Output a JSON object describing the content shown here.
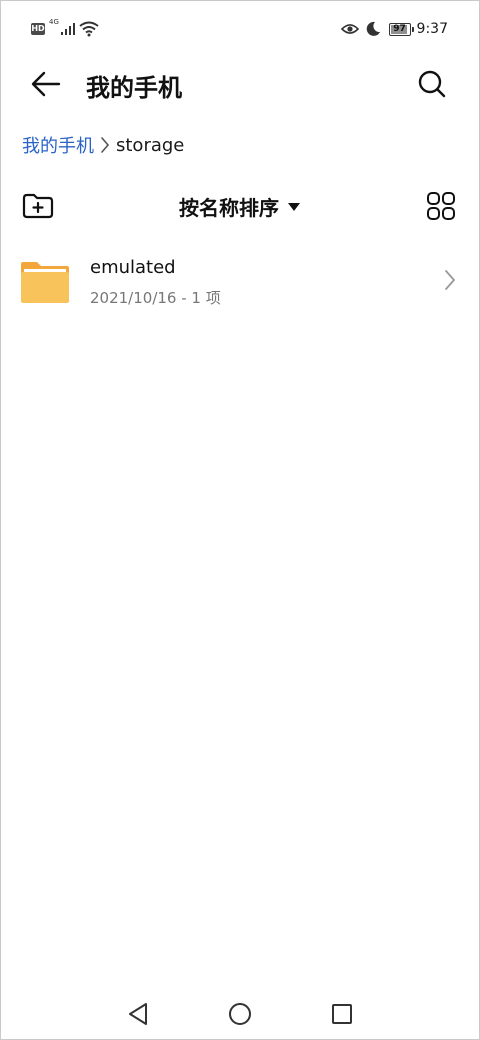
{
  "status_bar": {
    "hd_label": "HD",
    "network_label": "4G",
    "battery_level": 97,
    "battery_text": "97",
    "time": "9:37"
  },
  "title_bar": {
    "title": "我的手机"
  },
  "breadcrumb": {
    "root": "我的手机",
    "current": "storage"
  },
  "toolbar": {
    "sort_label": "按名称排序"
  },
  "files": [
    {
      "name": "emulated",
      "meta": "2021/10/16 - 1 项",
      "icon": "folder-icon",
      "color": "#f8c35a"
    }
  ],
  "colors": {
    "accent": "#2a63c8",
    "folder": "#f8c35a",
    "folder_tab": "#f2a73c"
  }
}
